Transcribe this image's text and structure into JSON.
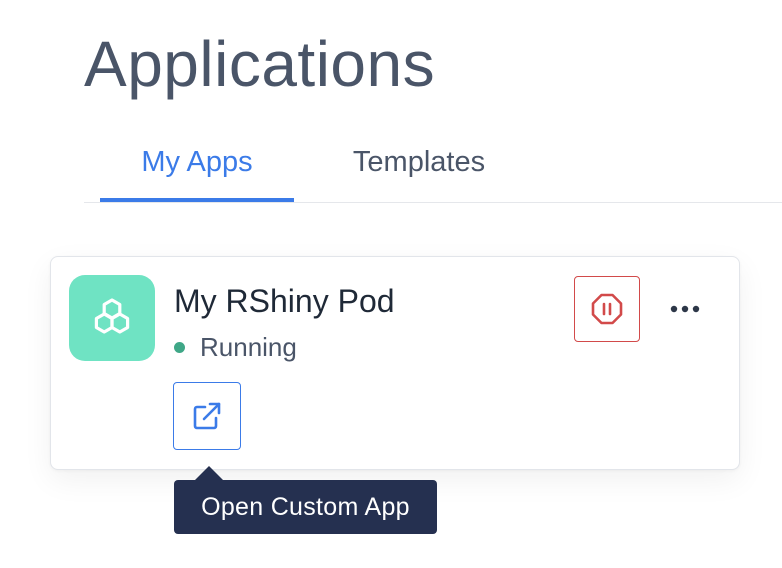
{
  "page": {
    "title": "Applications"
  },
  "tabs": [
    {
      "label": "My Apps",
      "active": true
    },
    {
      "label": "Templates",
      "active": false
    }
  ],
  "app": {
    "name": "My RShiny Pod",
    "status": "Running",
    "icon": "hexagon-cluster-icon",
    "status_color": "#3fa787",
    "icon_bg": "#6fe3c3"
  },
  "actions": {
    "stop_icon": "stop-octagon-icon",
    "more_icon": "more-horizontal-icon",
    "open_icon": "external-link-icon"
  },
  "tooltip": {
    "text": "Open Custom App"
  },
  "colors": {
    "accent": "#3b7be8",
    "danger": "#d24a4a",
    "tooltip_bg": "#253050"
  }
}
